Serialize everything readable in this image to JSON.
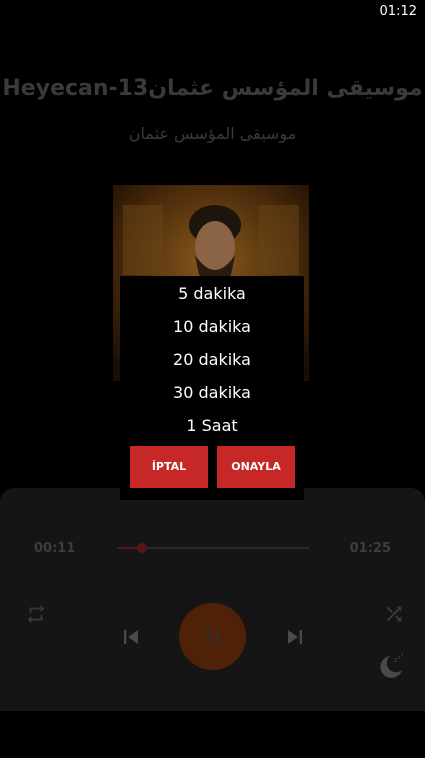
{
  "status": {
    "time": "01:12"
  },
  "song": {
    "title": "Heyecan-13موسيقى المؤسس عثمان",
    "artist": "موسيقى المؤسس عثمان"
  },
  "player": {
    "elapsed": "00:11",
    "total": "01:25",
    "progress": 0.13,
    "accent": "#c62828",
    "icons": [
      "repeat-icon",
      "previous-icon",
      "pause-icon",
      "next-icon",
      "shuffle-icon",
      "sleep-timer-icon"
    ]
  },
  "sleep_dialog": {
    "options": [
      "5 dakika",
      "10 dakika",
      "20 dakika",
      "30 dakika",
      "1 Saat"
    ],
    "cancel_label": "İPTAL",
    "confirm_label": "ONAYLA"
  }
}
